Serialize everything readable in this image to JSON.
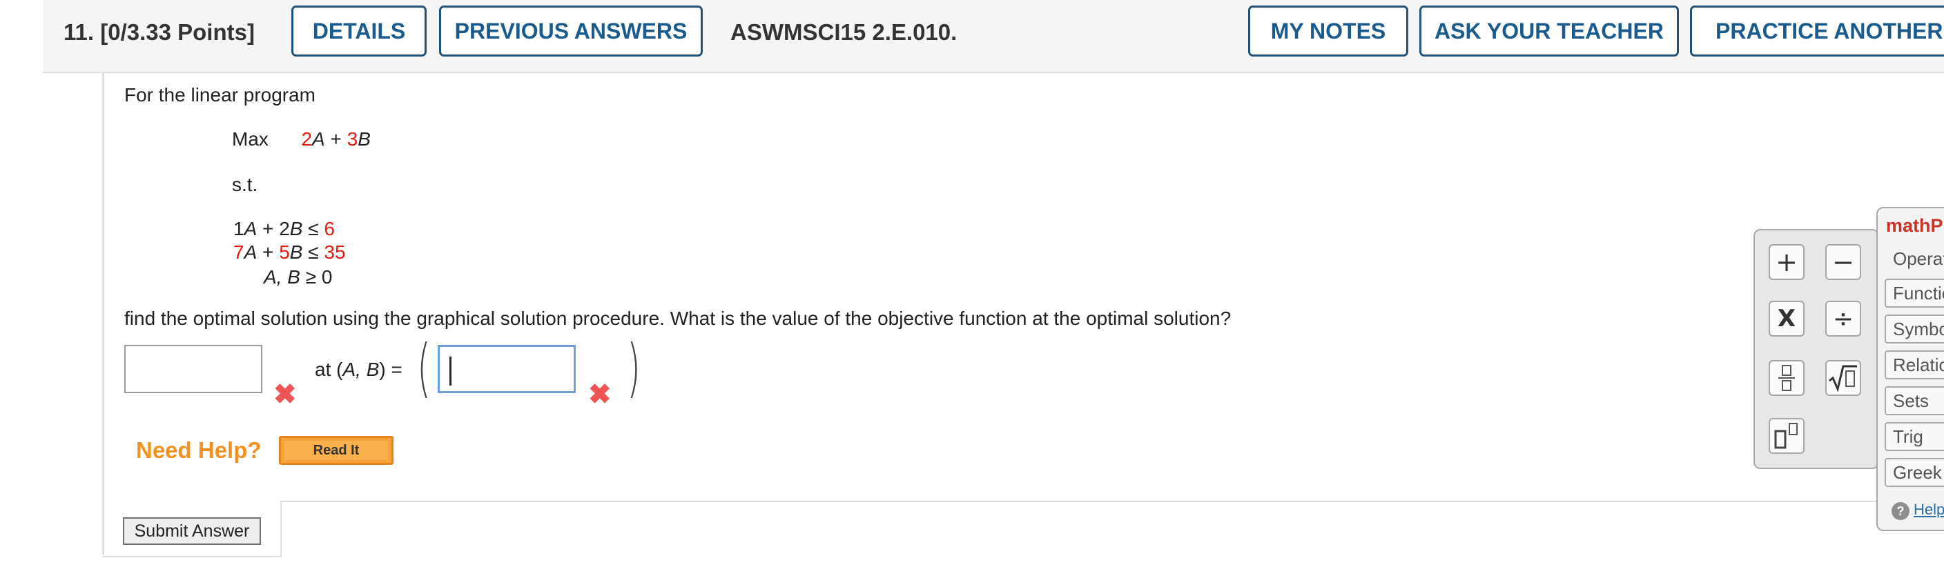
{
  "header": {
    "question_number": "11.",
    "points": "[0/3.33 Points]",
    "details_label": "DETAILS",
    "previous_answers_label": "PREVIOUS ANSWERS",
    "question_code": "ASWMSCI15 2.E.010.",
    "my_notes_label": "MY NOTES",
    "ask_teacher_label": "ASK YOUR TEACHER",
    "practice_another_label": "PRACTICE ANOTHER"
  },
  "question": {
    "intro": "For the linear program",
    "objective_keyword": "Max",
    "objective": {
      "coef_a": "2",
      "var_a": "A",
      "plus": "+",
      "coef_b": "3",
      "var_b": "B"
    },
    "st_label": "s.t.",
    "constraints": [
      {
        "coef_a": "1",
        "var_a": "A",
        "plus": "+",
        "coef_b": "2",
        "var_b": "B",
        "op": "≤",
        "rhs": "6",
        "red_coef_a": false,
        "red_coef_b": false
      },
      {
        "coef_a": "7",
        "var_a": "A",
        "plus": "+",
        "coef_b": "5",
        "var_b": "B",
        "op": "≤",
        "rhs": "35",
        "red_coef_a": true,
        "red_coef_b": true
      }
    ],
    "nonnegativity": {
      "vars": "A, B",
      "op": "≥",
      "rhs": "0"
    },
    "prompt": "find the optimal solution using the graphical solution procedure. What is the value of the objective function at the optimal solution?",
    "answer_value": "",
    "at_label_prefix": "at (",
    "at_vars": "A, B",
    "at_label_suffix": ") =",
    "answer_point": "",
    "incorrect_mark": "✖"
  },
  "help": {
    "need_help_label": "Need Help?",
    "read_it_label": "Read It"
  },
  "submit_label": "Submit Answer",
  "palette": {
    "keys": [
      "+",
      "−",
      "X",
      "÷",
      "fraction",
      "√▯",
      "power"
    ]
  },
  "math_panel": {
    "title": "mathP",
    "items": [
      "Operat",
      "Functio",
      "Symbo",
      "Relatio",
      "Sets",
      "Trig",
      "Greek"
    ],
    "help_label": "Help"
  },
  "colors": {
    "accent": "#1a5a8c",
    "error": "#ef5555",
    "highlight_red": "#e8190f",
    "need_help": "#f39221"
  }
}
